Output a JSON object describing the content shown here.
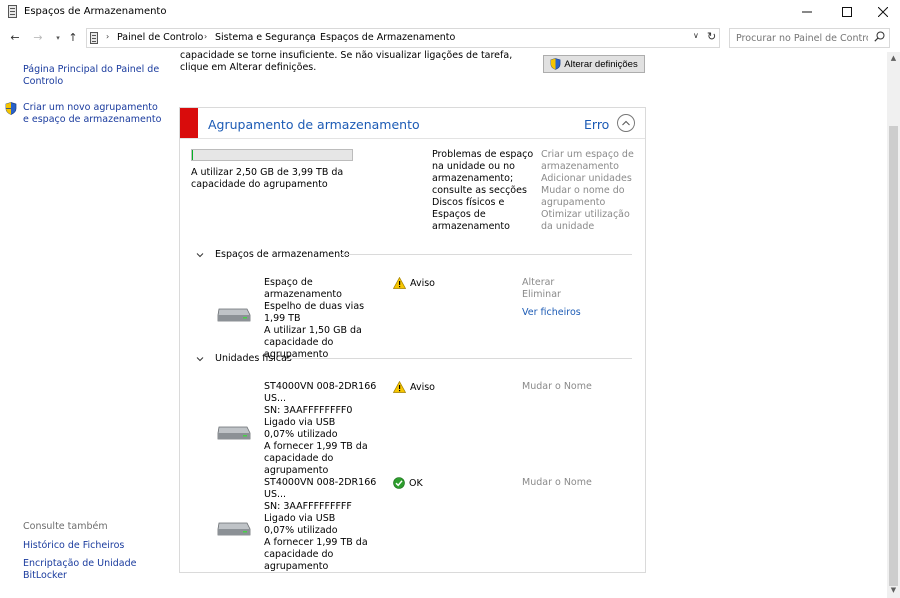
{
  "window": {
    "title": "Espaços de Armazenamento",
    "minimize_icon": "minimize-icon",
    "maximize_icon": "maximize-icon",
    "close_icon": "close-icon"
  },
  "address_bar": {
    "breadcrumbs": [
      "Painel de Controlo",
      "Sistema e Segurança",
      "Espaços de Armazenamento"
    ],
    "search_placeholder": "Procurar no Painel de Controlo"
  },
  "left_pane": {
    "home_link": "Página Principal do Painel de Controlo",
    "create_link": "Criar um novo agrupamento e espaço de armazenamento",
    "see_also": "Consulte também",
    "history_link": "Histórico de Ficheiros",
    "bitlocker_link": "Encriptação de Unidade BitLocker"
  },
  "main": {
    "intro_text": "capacidade se torne insuficiente. Se não visualizar ligações de tarefa, clique em Alterar definições.",
    "change_settings_button": "Alterar definições"
  },
  "pool": {
    "title": "Agrupamento de armazenamento",
    "status": "Erro",
    "usage_fraction": 0.0006,
    "usage_text": "A utilizar 2,50 GB de 3,99 TB da capacidade do agrupamento",
    "problem_text": "Problemas de espaço na unidade ou no armazenamento; consulte as secções Discos físicos e Espaços de armazenamento",
    "actions": [
      "Criar um espaço de armazenamento",
      "Adicionar unidades",
      "Mudar o nome do agrupamento",
      "Otimizar utilização da unidade"
    ]
  },
  "spaces_section": {
    "title": "Espaços de armazenamento",
    "items": [
      {
        "lines": [
          "Espaço de armazenamento",
          "Espelho de duas vias",
          "1,99 TB",
          "A utilizar 1,50 GB da capacidade do agrupamento"
        ],
        "status": "Aviso",
        "status_icon": "warning-icon",
        "actions": [
          "Alterar",
          "Eliminar"
        ],
        "link": "Ver ficheiros"
      }
    ]
  },
  "drives_section": {
    "title": "Unidades físicas",
    "items": [
      {
        "lines": [
          "ST4000VN 008-2DR166 US...",
          "SN: 3AAFFFFFFFF0",
          "Ligado via USB",
          "0,07% utilizado",
          "A fornecer 1,99 TB da capacidade do agrupamento"
        ],
        "status": "Aviso",
        "status_icon": "warning-icon",
        "action": "Mudar o Nome"
      },
      {
        "lines": [
          "ST4000VN 008-2DR166 US...",
          "SN: 3AAFFFFFFFFF",
          "Ligado via USB",
          "0,07% utilizado",
          "A fornecer 1,99 TB da capacidade do agrupamento"
        ],
        "status": "OK",
        "status_icon": "ok-check-icon",
        "action": "Mudar o Nome"
      }
    ]
  },
  "colors": {
    "link": "#1a3b9e",
    "accent_blue": "#1c5bb5",
    "error_red": "#d90c0c",
    "warning_yellow": "#f7c600",
    "ok_green": "#2d9d2d"
  }
}
